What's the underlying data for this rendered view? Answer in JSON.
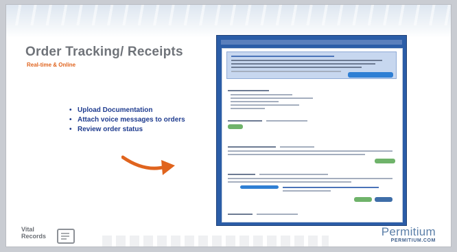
{
  "slide": {
    "title": "Order Tracking/ Receipts",
    "subtitle": "Real-time & Online",
    "bullets": [
      "Upload Documentation",
      "Attach voice messages to orders",
      "Review order status"
    ]
  },
  "footer": {
    "left_line1": "Vital",
    "left_line2": "Records",
    "brand_name": "Permitium",
    "brand_url": "PERMITIUM.COM"
  },
  "colors": {
    "title": "#6f7379",
    "subtitle": "#e0641e",
    "bullets": "#1f3c8f",
    "arrow": "#e0641e",
    "screenshot_frame": "#2b5da7",
    "brand": "#5b7fa8"
  }
}
